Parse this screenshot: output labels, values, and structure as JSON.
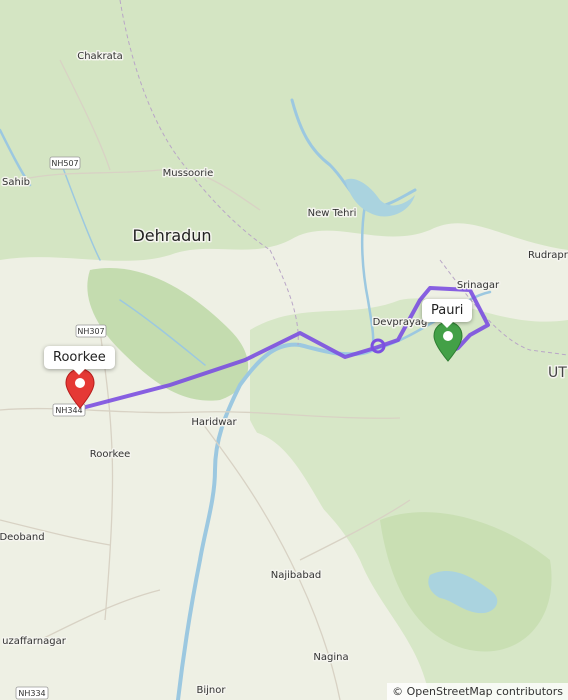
{
  "map": {
    "place_labels": {
      "chakrata": "Chakrata",
      "sahib": "Sahib",
      "mussoorie": "Mussoorie",
      "new_tehri": "New Tehri",
      "dehradun": "Dehradun",
      "srinagar": "Srinagar",
      "rudrapr": "Rudrapr",
      "devprayag": "Devprayag",
      "ut": "UT",
      "haridwar": "Haridwar",
      "roorkee": "Roorkee",
      "deoband": "Deoband",
      "najibabad": "Najibabad",
      "nagina": "Nagina",
      "uzaffarnagar": "uzaffarnagar",
      "bijnor": "Bijnor"
    },
    "road_shields": {
      "nh507": "NH507",
      "nh307": "NH307",
      "nh344": "NH344",
      "nh334": "NH334"
    },
    "markers": {
      "origin": {
        "label": "Roorkee",
        "color": "#e53935"
      },
      "destination": {
        "label": "Pauri",
        "color": "#43a047"
      }
    },
    "route": {
      "color": "#7b4fe0"
    },
    "colors": {
      "water": "#aad3df",
      "forest": "#c8e0b4",
      "land": "#eef0e4"
    },
    "attribution": "© OpenStreetMap contributors"
  }
}
